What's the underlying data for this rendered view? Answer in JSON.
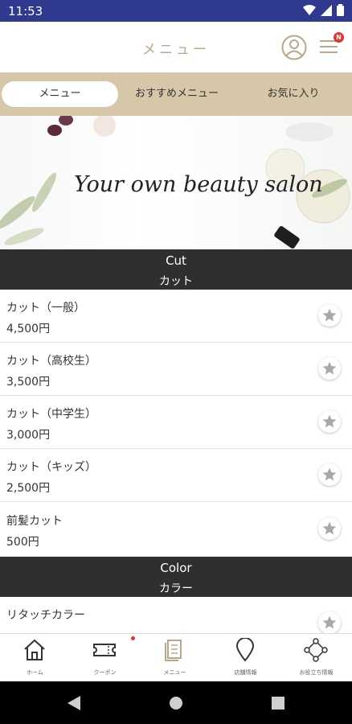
{
  "status_bar": {
    "time": "11:53",
    "signal_icon": "wifi-icon",
    "cell_icon": "signal-icon",
    "battery_icon": "battery-icon"
  },
  "header": {
    "title": "メニュー",
    "notification_badge": "N"
  },
  "tabs": [
    {
      "label": "メニュー",
      "active": true
    },
    {
      "label": "おすすめメニュー",
      "active": false
    },
    {
      "label": "お気に入り",
      "active": false
    }
  ],
  "banner": {
    "text": "Your own beauty salon"
  },
  "sections": [
    {
      "title_en": "Cut",
      "title_jp": "カット",
      "items": [
        {
          "name": "カット（一般）",
          "price": "4,500円"
        },
        {
          "name": "カット（高校生）",
          "price": "3,500円"
        },
        {
          "name": "カット（中学生）",
          "price": "3,000円"
        },
        {
          "name": "カット（キッズ）",
          "price": "2,500円"
        },
        {
          "name": "前髪カット",
          "price": "500円"
        }
      ]
    },
    {
      "title_en": "Color",
      "title_jp": "カラー",
      "items": [
        {
          "name": "リタッチカラー",
          "price": ""
        }
      ]
    }
  ],
  "bottom_nav": [
    {
      "label": "ホーム",
      "icon": "home-icon"
    },
    {
      "label": "クーポン",
      "icon": "ticket-icon"
    },
    {
      "label": "メニュー",
      "icon": "menu-book-icon"
    },
    {
      "label": "店舗情報",
      "icon": "location-pin-icon"
    },
    {
      "label": "お役立ち情報",
      "icon": "network-icon"
    }
  ],
  "colors": {
    "accent": "#d5c7a8",
    "title": "#b9a887",
    "section_bg": "#2f2f2f",
    "status_bar": "#2f3a8f"
  }
}
